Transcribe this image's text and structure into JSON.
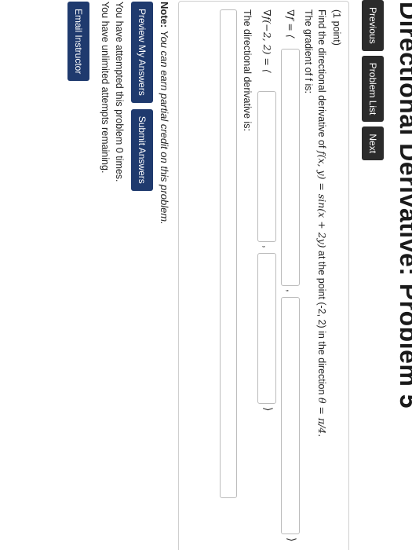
{
  "page": {
    "title": "Directional Derivative: Problem 5"
  },
  "nav": {
    "previous_label": "Previous",
    "problem_list_label": "Problem List",
    "next_label": "Next"
  },
  "problem": {
    "points": "(1 point)",
    "prompt_text": "Find the directional derivative of",
    "function": "f(x, y) = sin(x + 2y)",
    "at_point_text": "at the point (-2, 2) in the direction",
    "direction": "θ = π/4.",
    "gradient_prompt": "The gradient of f is:",
    "gradient_label": "∇f = ⟨",
    "gradient_at_point_label": "∇f(−2, 2) = ⟨",
    "separator": ",",
    "close_bracket": "⟩",
    "directional_prompt": "The directional derivative is:",
    "inputs": {
      "grad_x": "",
      "grad_y": "",
      "grad_point_x": "",
      "grad_point_y": "",
      "directional": ""
    }
  },
  "note": {
    "label": "Note:",
    "text": "You can earn partial credit on this problem."
  },
  "actions": {
    "preview_label": "Preview My Answers",
    "submit_label": "Submit Answers"
  },
  "status": {
    "attempts_text": "You have attempted this problem 0 times.",
    "remaining_text": "You have unlimited attempts remaining."
  },
  "footer": {
    "email_label": "Email Instructor"
  }
}
